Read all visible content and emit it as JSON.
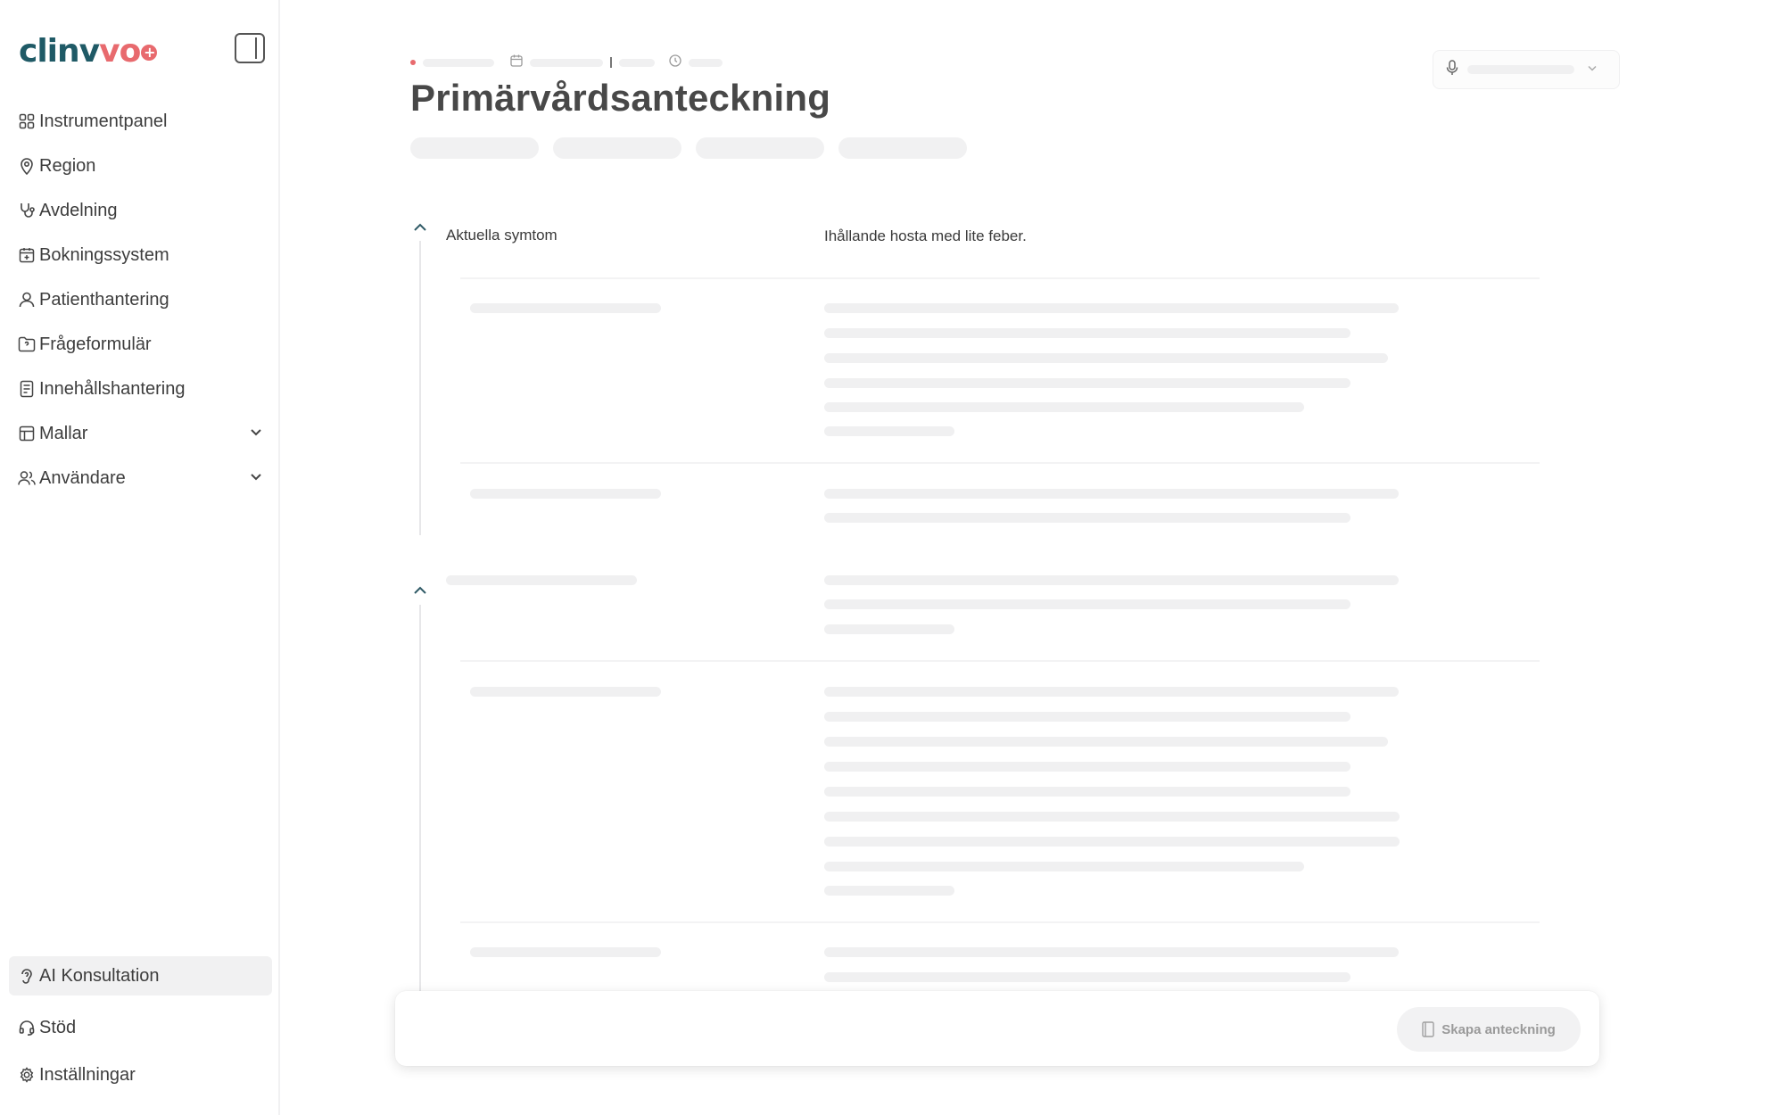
{
  "app": {
    "logo_text_main": "clinv",
    "logo_text_accent": "vo",
    "logo_plus": "+"
  },
  "sidebar": {
    "items": [
      {
        "label": "Instrumentpanel",
        "icon": "grid-icon"
      },
      {
        "label": "Region",
        "icon": "map-pin-icon"
      },
      {
        "label": "Avdelning",
        "icon": "stethoscope-icon"
      },
      {
        "label": "Bokningssystem",
        "icon": "calendar-plus-icon"
      },
      {
        "label": "Patienthantering",
        "icon": "user-icon"
      },
      {
        "label": "Frågeformulär",
        "icon": "folder-question-icon"
      },
      {
        "label": "Innehållshantering",
        "icon": "document-icon"
      },
      {
        "label": "Mallar",
        "icon": "table-icon",
        "expandable": true
      },
      {
        "label": "Användare",
        "icon": "users-icon",
        "expandable": true
      }
    ],
    "bottom_items": [
      {
        "label": "AI Konsultation",
        "icon": "ear-icon",
        "active": true
      },
      {
        "label": "Stöd",
        "icon": "headset-icon"
      },
      {
        "label": "Inställningar",
        "icon": "gear-icon"
      }
    ]
  },
  "main": {
    "title": "Primärvårdsanteckning",
    "sections": [
      {
        "fields": [
          {
            "label": "Aktuella symtom",
            "value": "Ihållande hosta med lite feber."
          }
        ]
      }
    ],
    "create_button_label": "Skapa anteckning"
  },
  "colors": {
    "brand_teal": "#1f5a66",
    "brand_coral": "#e86a6e",
    "skeleton": "#f0f0f1"
  }
}
